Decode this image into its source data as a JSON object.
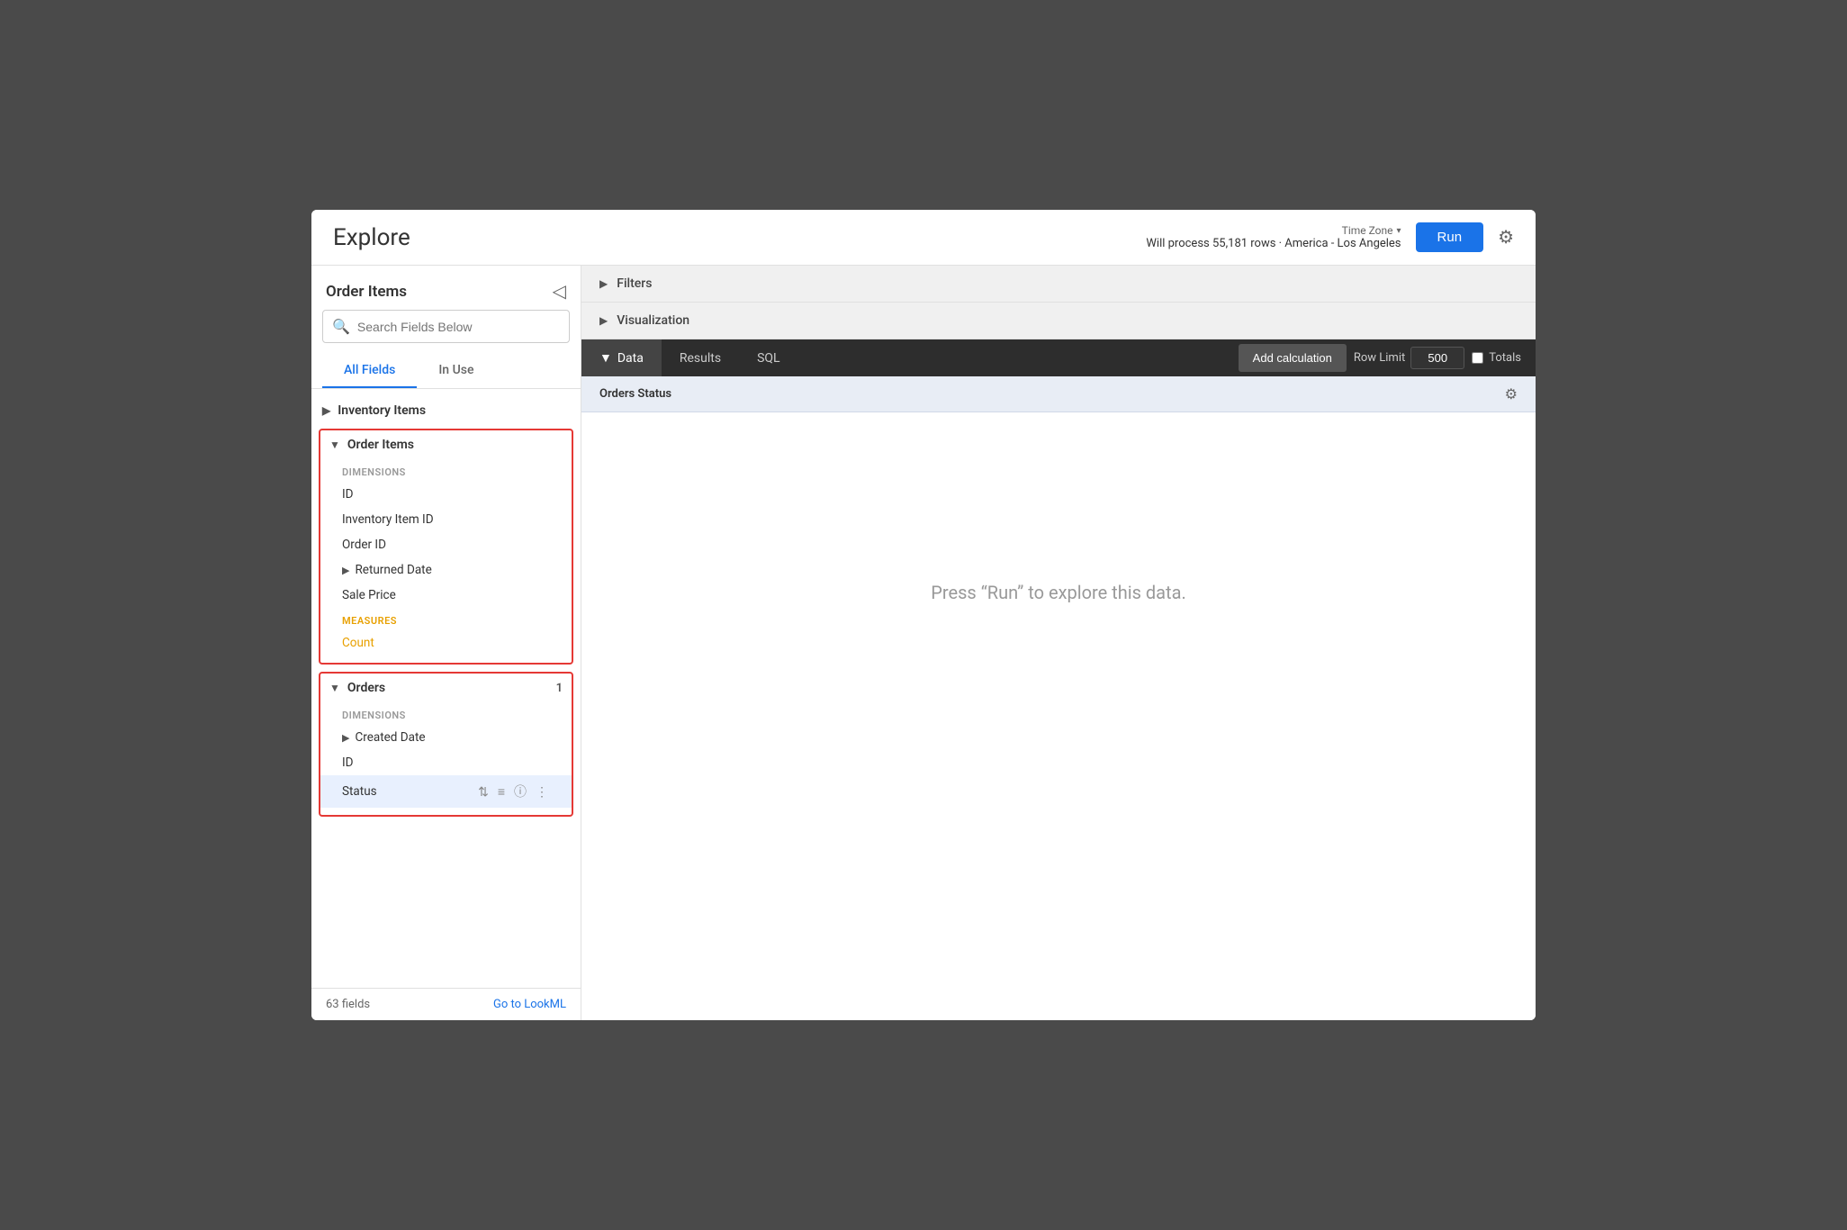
{
  "header": {
    "title": "Explore",
    "time_zone_label": "Time Zone",
    "time_zone_chevron": "▾",
    "process_info": "Will process 55,181 rows · America - Los Angeles",
    "run_button": "Run"
  },
  "sidebar": {
    "title": "Order Items",
    "search_placeholder": "Search Fields Below",
    "tabs": [
      {
        "label": "All Fields",
        "active": true
      },
      {
        "label": "In Use",
        "active": false
      }
    ],
    "sections": [
      {
        "label": "Inventory Items",
        "collapsed": true,
        "red_border": false,
        "badge": ""
      },
      {
        "label": "Order Items",
        "collapsed": false,
        "red_border": true,
        "badge": "",
        "sub_sections": [
          {
            "type": "dimensions",
            "label": "DIMENSIONS",
            "items": [
              {
                "label": "ID",
                "has_chevron": false
              },
              {
                "label": "Inventory Item ID",
                "has_chevron": false
              },
              {
                "label": "Order ID",
                "has_chevron": false
              },
              {
                "label": "Returned Date",
                "has_chevron": true
              },
              {
                "label": "Sale Price",
                "has_chevron": false
              }
            ]
          },
          {
            "type": "measures",
            "label": "MEASURES",
            "items": [
              {
                "label": "Count",
                "has_chevron": false
              }
            ]
          }
        ]
      },
      {
        "label": "Orders",
        "collapsed": false,
        "red_border": true,
        "badge": "1",
        "sub_sections": [
          {
            "type": "dimensions",
            "label": "DIMENSIONS",
            "items": [
              {
                "label": "Created Date",
                "has_chevron": true
              },
              {
                "label": "ID",
                "has_chevron": false
              },
              {
                "label": "Status",
                "has_chevron": false,
                "active": true
              }
            ]
          }
        ]
      }
    ],
    "footer": {
      "fields_count": "63 fields",
      "go_to_lookml": "Go to LookML"
    }
  },
  "right_panel": {
    "filters_label": "Filters",
    "visualization_label": "Visualization",
    "toolbar": {
      "tabs": [
        {
          "label": "Data",
          "active": true,
          "has_chevron": true
        },
        {
          "label": "Results",
          "active": false
        },
        {
          "label": "SQL",
          "active": false
        }
      ],
      "add_calc_label": "Add calculation",
      "row_limit_label": "Row Limit",
      "row_limit_value": "500",
      "totals_label": "Totals"
    },
    "data_header": {
      "column_label": "Orders Status"
    },
    "empty_state": "Press “Run” to explore this data."
  }
}
